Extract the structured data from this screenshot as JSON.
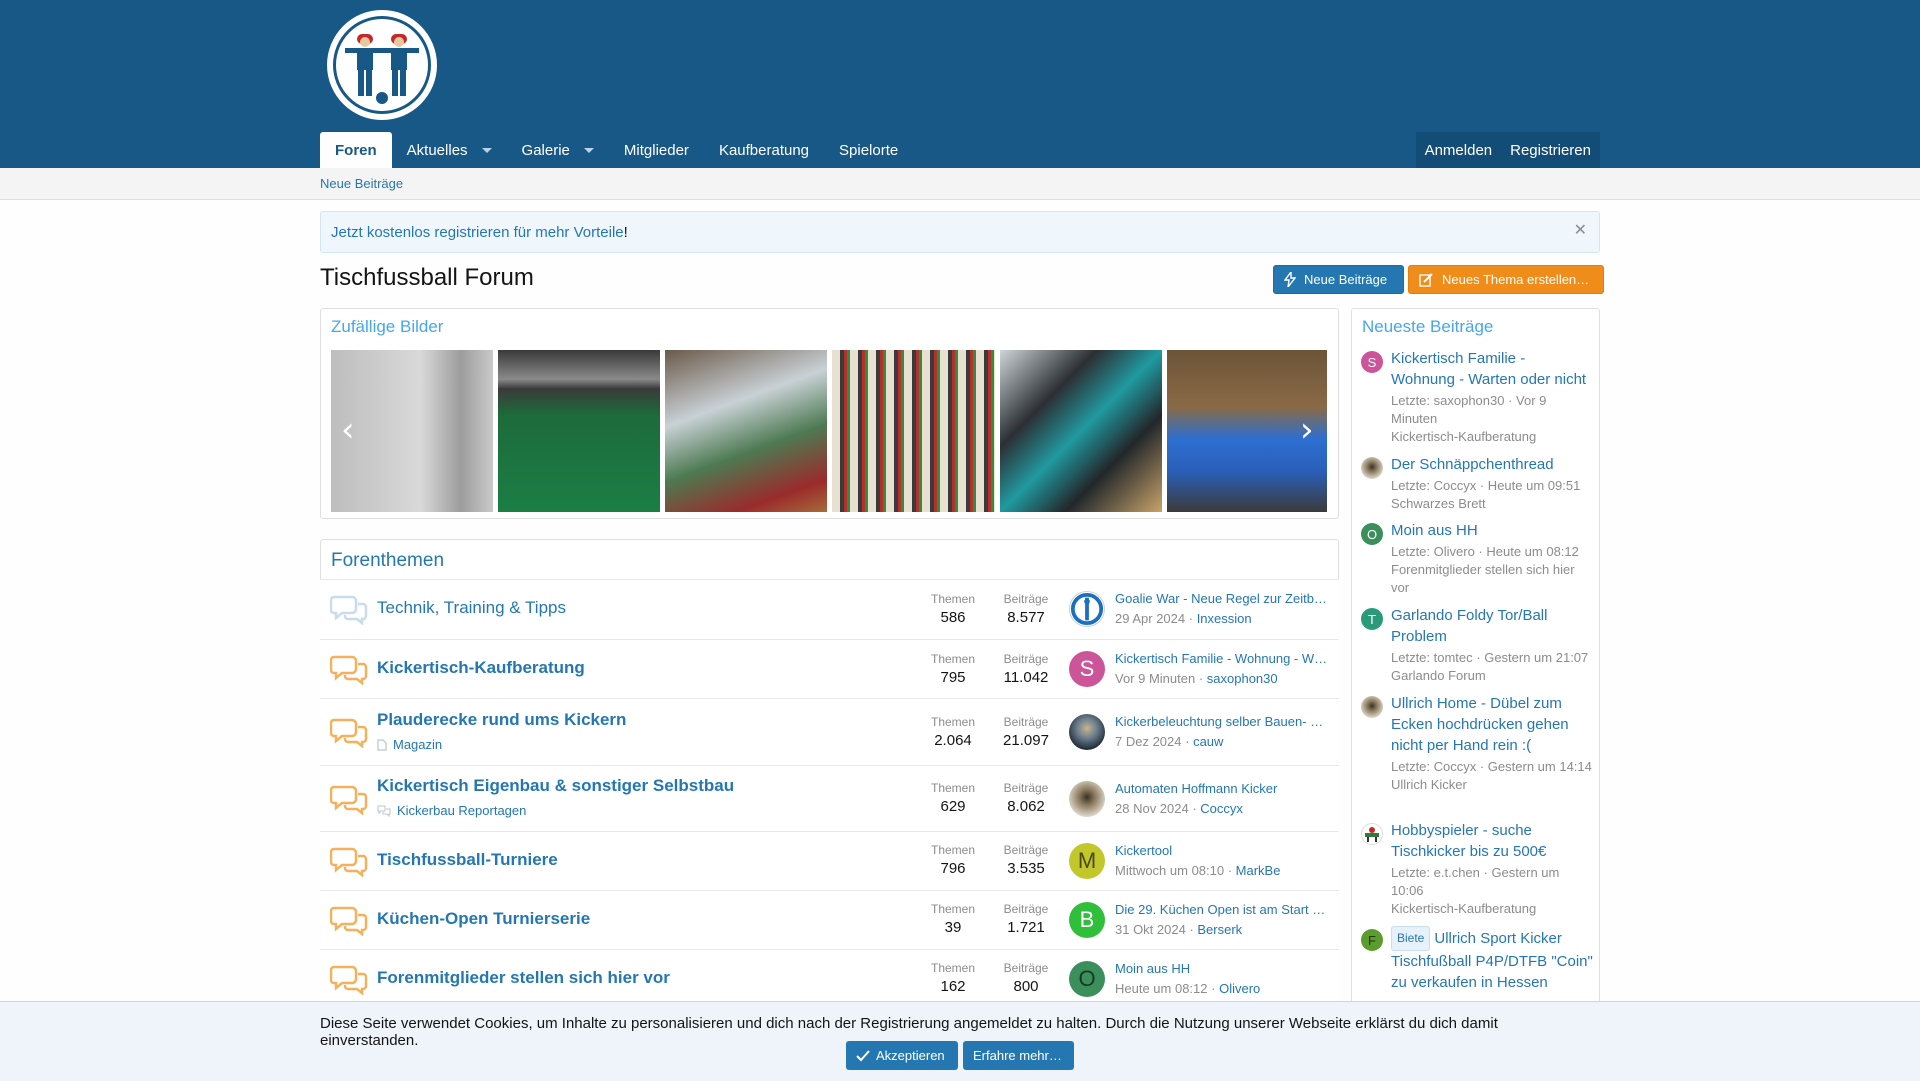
{
  "nav": {
    "items": [
      "Foren",
      "Aktuelles",
      "Galerie",
      "Mitglieder",
      "Kaufberatung",
      "Spielorte"
    ],
    "login": "Anmelden",
    "register": "Registrieren"
  },
  "subnav": {
    "new_posts": "Neue Beiträge"
  },
  "notice": {
    "link": "Jetzt kostenlos registrieren für mehr Vorteile",
    "suffix": "!"
  },
  "page": {
    "title": "Tischfussball Forum",
    "btn_new_posts": "Neue Beiträge",
    "btn_new_thread": "Neues Thema erstellen…"
  },
  "gallery": {
    "title": "Zufällige Bilder"
  },
  "forums": {
    "title": "Forenthemen",
    "label_threads": "Themen",
    "label_posts": "Beiträge",
    "rows": [
      {
        "name": "Technik, Training & Tipps",
        "sub": "",
        "threads": "586",
        "posts": "8.577",
        "last_title": "Goalie War - Neue Regel zur Zeitb…",
        "last_date": "29 Apr 2024",
        "last_user": "Inxession",
        "avatar_letter": "",
        "avatar_color": "#ffffff"
      },
      {
        "name": "Kickertisch-Kaufberatung",
        "sub": "",
        "threads": "795",
        "posts": "11.042",
        "last_title": "Kickertisch Familie - Wohnung - W…",
        "last_date": "Vor 9 Minuten",
        "last_user": "saxophon30",
        "avatar_letter": "S",
        "avatar_color": "#cc5599"
      },
      {
        "name": "Plauderecke rund ums Kickern",
        "sub": "Magazin",
        "threads": "2.064",
        "posts": "21.097",
        "last_title": "Kickerbeleuchtung selber Bauen- …",
        "last_date": "7 Dez 2024",
        "last_user": "cauw",
        "avatar_letter": "",
        "avatar_color": "#2b3a48"
      },
      {
        "name": "Kickertisch Eigenbau & sonstiger Selbstbau",
        "sub": "Kickerbau Reportagen",
        "threads": "629",
        "posts": "8.062",
        "last_title": "Automaten Hoffmann Kicker",
        "last_date": "28 Nov 2024",
        "last_user": "Coccyx",
        "avatar_letter": "",
        "avatar_color": "#b8ab90"
      },
      {
        "name": "Tischfussball-Turniere",
        "sub": "",
        "threads": "796",
        "posts": "3.535",
        "last_title": "Kickertool",
        "last_date": "Mittwoch um 08:10",
        "last_user": "MarkBe",
        "avatar_letter": "M",
        "avatar_color": "#c2c82b"
      },
      {
        "name": "Küchen-Open Turnierserie",
        "sub": "",
        "threads": "39",
        "posts": "1.721",
        "last_title": "Die 29. Küchen Open ist am Start …",
        "last_date": "31 Okt 2024",
        "last_user": "Berserk",
        "avatar_letter": "B",
        "avatar_color": "#2fbf3a"
      },
      {
        "name": "Forenmitglieder stellen sich hier vor",
        "sub": "",
        "threads": "162",
        "posts": "800",
        "last_title": "Moin aus HH",
        "last_date": "Heute um 08:12",
        "last_user": "Olivero",
        "avatar_letter": "O",
        "avatar_color": "#3a8f5a"
      }
    ]
  },
  "sidebar": {
    "title": "Neueste Beiträge",
    "items": [
      {
        "title": "Kickertisch Familie - Wohnung - Warten oder nicht",
        "meta": "Letzte: saxophon30 · Vor 9 Minuten",
        "forum": "Kickertisch-Kaufberatung",
        "avatar_letter": "S",
        "avatar_color": "#cc5599",
        "badge": ""
      },
      {
        "title": "Der Schnäppchenthread",
        "meta": "Letzte: Coccyx · Heute um 09:51",
        "forum": "Schwarzes Brett",
        "avatar_letter": "",
        "avatar_color": "#b8ab90",
        "badge": ""
      },
      {
        "title": "Moin aus HH",
        "meta": "Letzte: Olivero · Heute um 08:12",
        "forum": "Forenmitglieder stellen sich hier vor",
        "avatar_letter": "O",
        "avatar_color": "#3a8f5a",
        "badge": ""
      },
      {
        "title": "Garlando Foldy Tor/Ball Problem",
        "meta": "Letzte: tomtec · Gestern um 21:07",
        "forum": "Garlando Forum",
        "avatar_letter": "T",
        "avatar_color": "#2a9a7a",
        "badge": ""
      },
      {
        "title": "Ullrich Home - Dübel zum Ecken hochdrücken gehen nicht per Hand rein :(",
        "meta": "Letzte: Coccyx · Gestern um 14:14",
        "forum": "Ullrich Kicker",
        "avatar_letter": "",
        "avatar_color": "#b8ab90",
        "badge": ""
      },
      {
        "title": "Hobbyspieler - suche Tischkicker bis zu 500€",
        "meta": "Letzte: e.t.chen · Gestern um 10:06",
        "forum": "Kickertisch-Kaufberatung",
        "avatar_letter": "",
        "avatar_color": "#ffffff",
        "badge": ""
      },
      {
        "title": "Ullrich Sport Kicker Tischfußball P4P/DTFB \"Coin\" zu verkaufen in Hessen",
        "meta": "",
        "forum": "",
        "avatar_letter": "F",
        "avatar_color": "#5c9c2e",
        "badge": "Biete"
      }
    ]
  },
  "cookie": {
    "text": "Diese Seite verwendet Cookies, um Inhalte zu personalisieren und dich nach der Registrierung angemeldet zu halten. Durch die Nutzung unserer Webseite erklärst du dich damit einverstanden.",
    "accept": "Akzeptieren",
    "more": "Erfahre mehr…"
  },
  "colors": {
    "header": "#185886",
    "link": "#2577b1",
    "accent": "#47a7eb",
    "orange": "#ef8c1a"
  }
}
